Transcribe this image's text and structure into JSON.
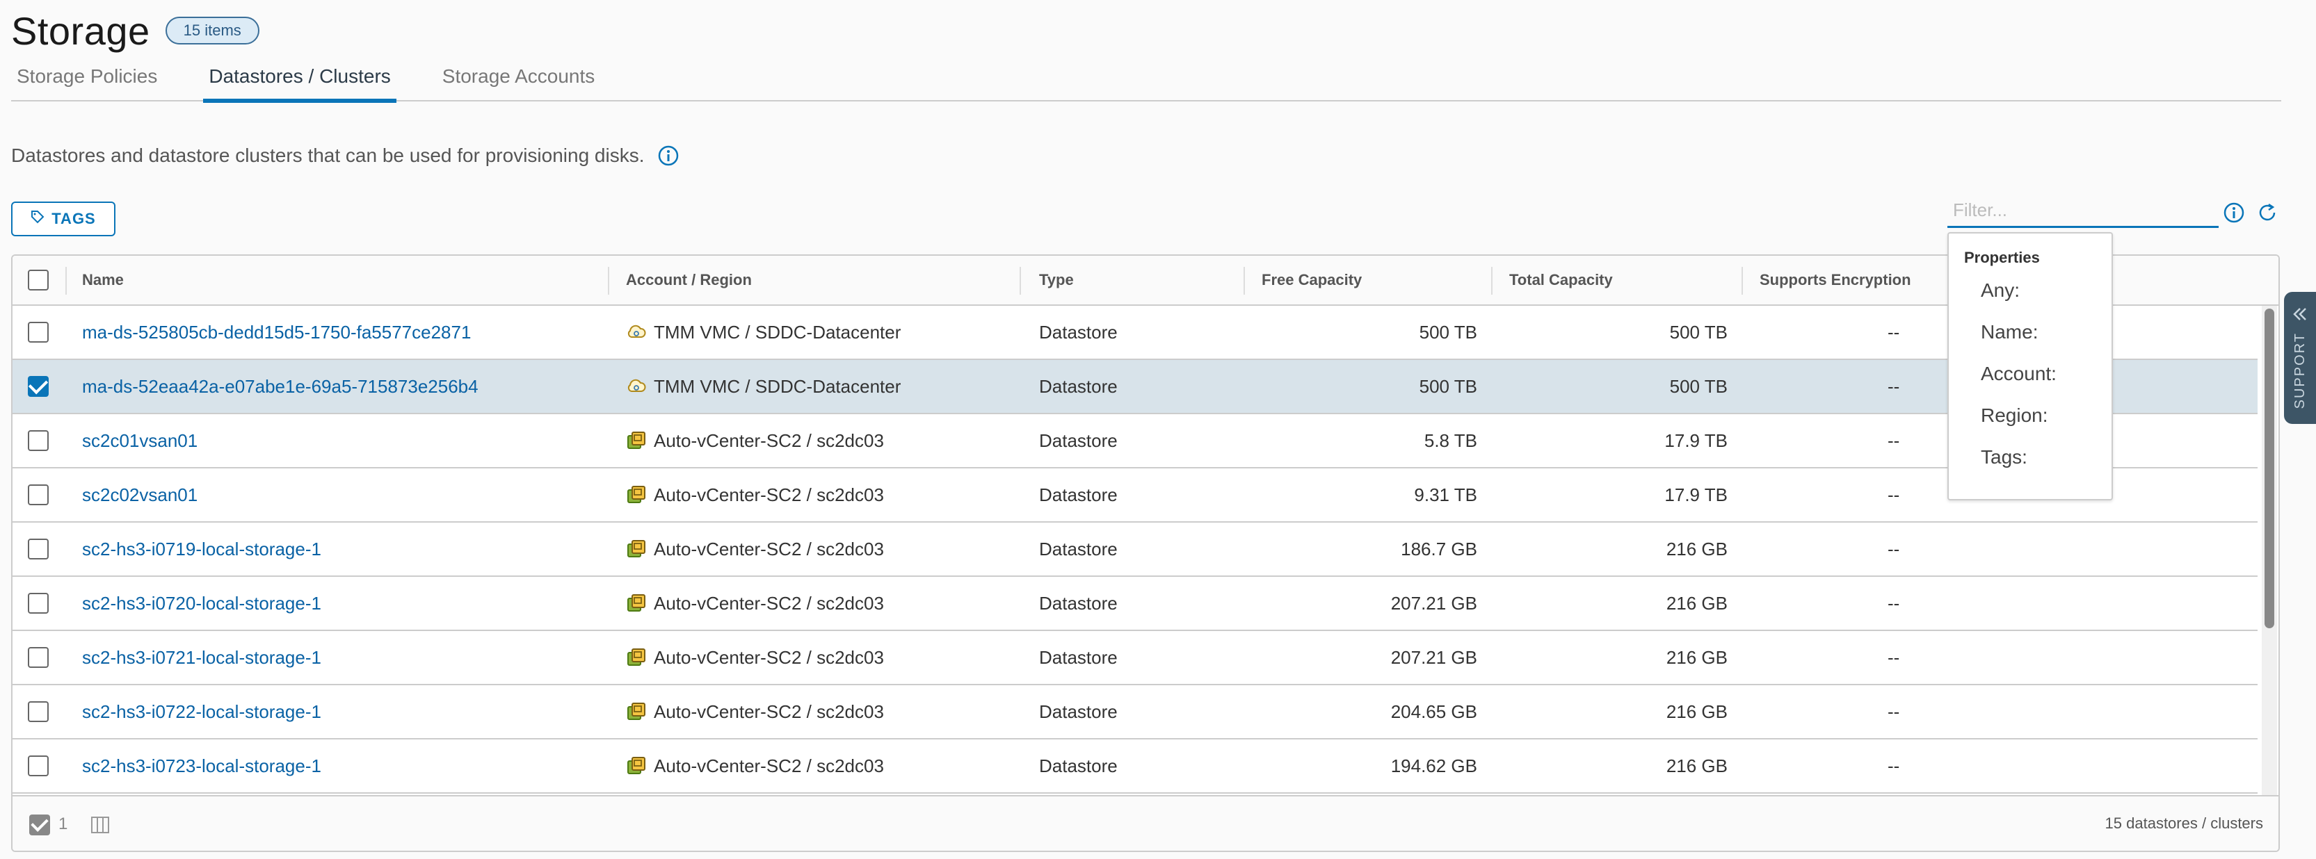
{
  "header": {
    "title": "Storage",
    "badge": "15 items"
  },
  "tabs": [
    {
      "label": "Storage Policies"
    },
    {
      "label": "Datastores / Clusters"
    },
    {
      "label": "Storage Accounts"
    }
  ],
  "description": "Datastores and datastore clusters that can be used for provisioning disks.",
  "toolbar": {
    "tags_label": "TAGS",
    "filter_placeholder": "Filter..."
  },
  "table": {
    "columns": [
      "Name",
      "Account / Region",
      "Type",
      "Free Capacity",
      "Total Capacity",
      "Supports Encryption"
    ],
    "rows": [
      {
        "name": "ma-ds-525805cb-dedd15d5-1750-fa5577ce2871",
        "region": "TMM VMC / SDDC-Datacenter",
        "type": "Datastore",
        "free": "500 TB",
        "total": "500 TB",
        "encryption": "--",
        "icon": "cloud-icon",
        "selected": false
      },
      {
        "name": "ma-ds-52eaa42a-e07abe1e-69a5-715873e256b4",
        "region": "TMM VMC / SDDC-Datacenter",
        "type": "Datastore",
        "free": "500 TB",
        "total": "500 TB",
        "encryption": "--",
        "icon": "cloud-icon",
        "selected": true
      },
      {
        "name": "sc2c01vsan01",
        "region": "Auto-vCenter-SC2 / sc2dc03",
        "type": "Datastore",
        "free": "5.8 TB",
        "total": "17.9 TB",
        "encryption": "--",
        "icon": "vcenter-icon",
        "selected": false
      },
      {
        "name": "sc2c02vsan01",
        "region": "Auto-vCenter-SC2 / sc2dc03",
        "type": "Datastore",
        "free": "9.31 TB",
        "total": "17.9 TB",
        "encryption": "--",
        "icon": "vcenter-icon",
        "selected": false
      },
      {
        "name": "sc2-hs3-i0719-local-storage-1",
        "region": "Auto-vCenter-SC2 / sc2dc03",
        "type": "Datastore",
        "free": "186.7 GB",
        "total": "216 GB",
        "encryption": "--",
        "icon": "vcenter-icon",
        "selected": false
      },
      {
        "name": "sc2-hs3-i0720-local-storage-1",
        "region": "Auto-vCenter-SC2 / sc2dc03",
        "type": "Datastore",
        "free": "207.21 GB",
        "total": "216 GB",
        "encryption": "--",
        "icon": "vcenter-icon",
        "selected": false
      },
      {
        "name": "sc2-hs3-i0721-local-storage-1",
        "region": "Auto-vCenter-SC2 / sc2dc03",
        "type": "Datastore",
        "free": "207.21 GB",
        "total": "216 GB",
        "encryption": "--",
        "icon": "vcenter-icon",
        "selected": false
      },
      {
        "name": "sc2-hs3-i0722-local-storage-1",
        "region": "Auto-vCenter-SC2 / sc2dc03",
        "type": "Datastore",
        "free": "204.65 GB",
        "total": "216 GB",
        "encryption": "--",
        "icon": "vcenter-icon",
        "selected": false
      },
      {
        "name": "sc2-hs3-i0723-local-storage-1",
        "region": "Auto-vCenter-SC2 / sc2dc03",
        "type": "Datastore",
        "free": "194.62 GB",
        "total": "216 GB",
        "encryption": "--",
        "icon": "vcenter-icon",
        "selected": false
      }
    ]
  },
  "footer": {
    "selected_count": "1",
    "total": "15 datastores / clusters"
  },
  "filter_dropdown": {
    "heading": "Properties",
    "items": [
      "Any:",
      "Name:",
      "Account:",
      "Region:",
      "Tags:"
    ]
  },
  "support": {
    "label": "SUPPORT"
  },
  "colors": {
    "accent": "#0a75b8",
    "selected_row": "#d8e3ea",
    "support_tab": "#3d5566"
  }
}
